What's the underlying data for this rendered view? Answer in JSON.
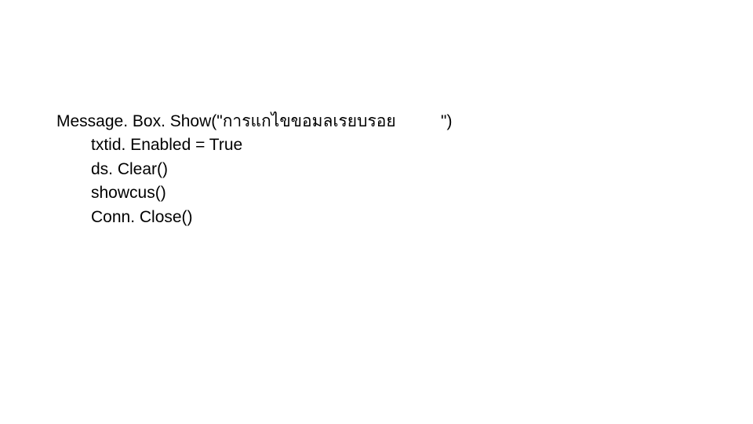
{
  "code": {
    "line1_prefix": "Message. Box. Show(\"",
    "line1_thai": "การแกไขขอมลเรยบรอย",
    "line1_suffix": "\")",
    "line2": "txtid. Enabled = True",
    "line3": "ds. Clear()",
    "line4": "showcus()",
    "line5": "Conn. Close()"
  }
}
